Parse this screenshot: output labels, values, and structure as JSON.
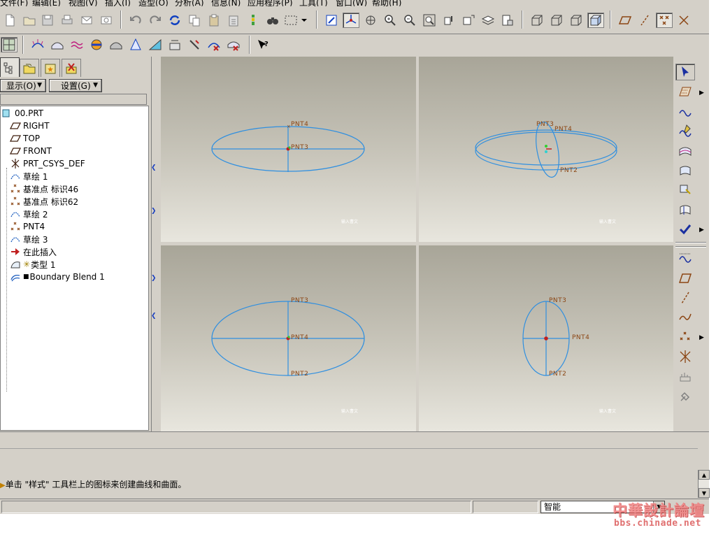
{
  "menubar": {
    "items": [
      "文件(F)",
      "编辑(E)",
      "视图(V)",
      "插入(I)",
      "造型(O)",
      "分析(A)",
      "信息(N)",
      "应用程序(P)",
      "工具(T)",
      "窗口(W)",
      "帮助(H)"
    ]
  },
  "tree_panel": {
    "display_label": "显示(O)",
    "settings_label": "设置(G)",
    "items": [
      {
        "label": "00.PRT",
        "icon": "part-icon"
      },
      {
        "label": "RIGHT",
        "icon": "datum-plane-icon"
      },
      {
        "label": "TOP",
        "icon": "datum-plane-icon"
      },
      {
        "label": "FRONT",
        "icon": "datum-plane-icon"
      },
      {
        "label": "PRT_CSYS_DEF",
        "icon": "csys-icon"
      },
      {
        "label": "草绘 1",
        "icon": "sketch-icon"
      },
      {
        "label": "基准点 标识46",
        "icon": "datum-point-icon"
      },
      {
        "label": "基准点 标识62",
        "icon": "datum-point-icon"
      },
      {
        "label": "草绘 2",
        "icon": "sketch-icon"
      },
      {
        "label": "PNT4",
        "icon": "datum-point-icon"
      },
      {
        "label": "草绘 3",
        "icon": "sketch-icon"
      },
      {
        "label": "在此插入",
        "icon": "insert-here-arrow-icon"
      },
      {
        "label": "类型 1",
        "icon": "style-feature-icon"
      },
      {
        "label": "Boundary Blend 1",
        "icon": "boundary-blend-icon"
      }
    ]
  },
  "viewports": {
    "top_left": {
      "labels": [
        "PNT4",
        "PNT3"
      ],
      "tag": "输入曹文"
    },
    "top_right": {
      "labels": [
        "PNT3",
        "PNT4",
        "PNT2"
      ],
      "tag": "输入曹文"
    },
    "bottom_left": {
      "labels": [
        "PNT3",
        "PNT4",
        "PNT2"
      ],
      "tag": "输入曹文"
    },
    "bottom_right": {
      "labels": [
        "PNT3",
        "PNT4",
        "PNT2"
      ],
      "tag": "输入曹文"
    }
  },
  "message": {
    "text": "单击 \"样式\" 工具栏上的图标来创建曲线和曲面。"
  },
  "status": {
    "filter_value": "智能"
  },
  "watermark": {
    "line1": "中華設計論壇",
    "line2": "bbs.chinade.net"
  },
  "colors": {
    "curve": "#2f8fe0",
    "label": "#8b4513",
    "point_marker": "#c02020",
    "ui_face": "#d4d0c8"
  }
}
